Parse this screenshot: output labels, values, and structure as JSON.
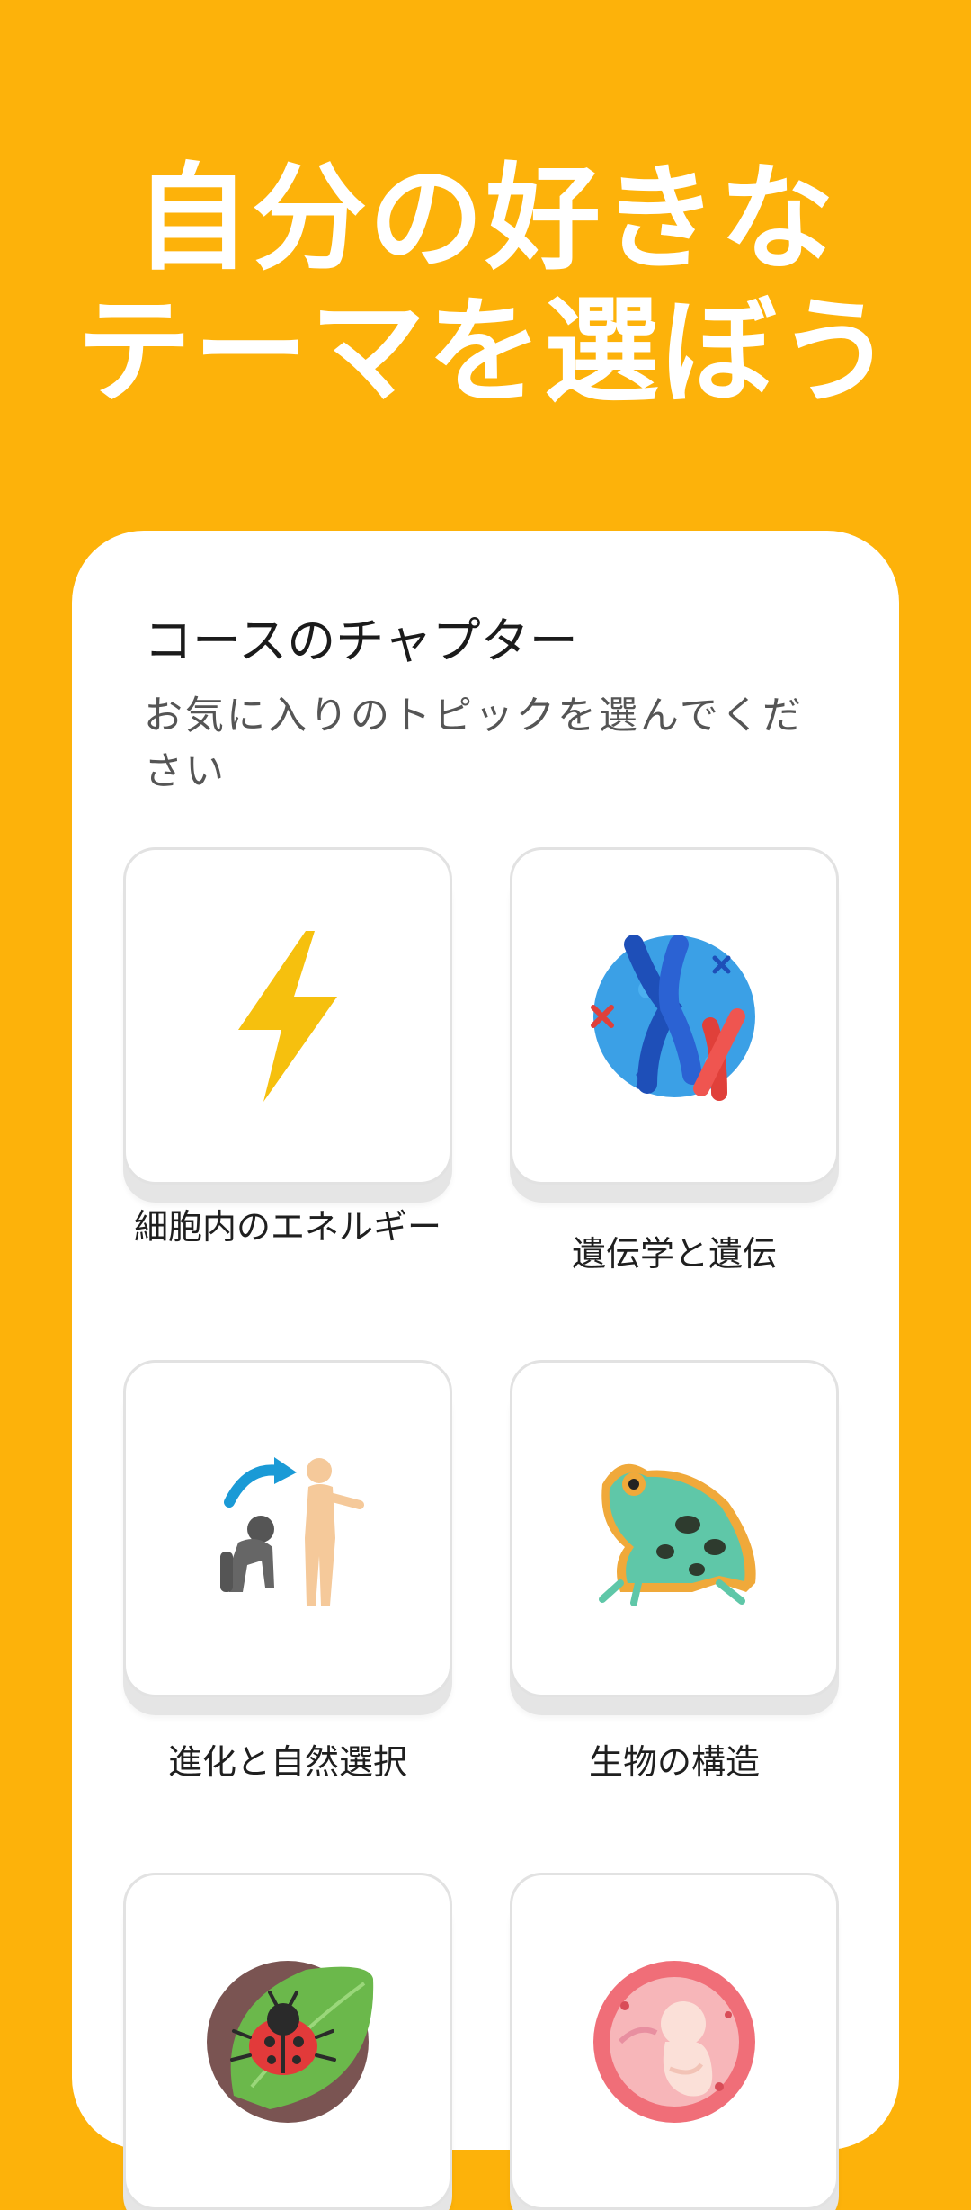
{
  "headline": {
    "line1": "自分の好きな",
    "line2": "テーマを選ぼう"
  },
  "card": {
    "title": "コースのチャプター",
    "subtitle": "お気に入りのトピックを選んでください",
    "topics": [
      {
        "label": "細胞内のエネルギー",
        "icon": "lightning-icon"
      },
      {
        "label": "遺伝学と遺伝",
        "icon": "chromosome-icon"
      },
      {
        "label": "進化と自然選択",
        "icon": "evolution-icon"
      },
      {
        "label": "生物の構造",
        "icon": "frog-icon"
      },
      {
        "label": "",
        "icon": "ladybug-leaf-icon"
      },
      {
        "label": "",
        "icon": "embryo-icon"
      }
    ]
  }
}
